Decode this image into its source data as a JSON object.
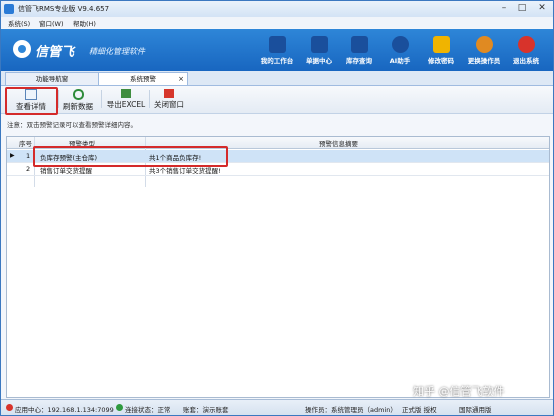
{
  "window": {
    "title": "信管飞RMS专业版 V9.4.657"
  },
  "menu": [
    "系统(S)",
    "窗口(W)",
    "帮助(H)"
  ],
  "banner": {
    "logo": "信管飞",
    "slogan": "精细化管理软件",
    "tools": [
      {
        "label": "我的工作台",
        "icon": "monitor-icon",
        "color": "#1a4f9c"
      },
      {
        "label": "单据中心",
        "icon": "document-list-icon",
        "color": "#1a4f9c"
      },
      {
        "label": "库存查询",
        "icon": "warehouse-icon",
        "color": "#1a4f9c"
      },
      {
        "label": "AI助手",
        "icon": "info-bubble-icon",
        "color": "#1a4f9c"
      },
      {
        "label": "修改密码",
        "icon": "lock-icon",
        "color": "#f0b400"
      },
      {
        "label": "更换操作员",
        "icon": "user-icon",
        "color": "#e08a22"
      },
      {
        "label": "退出系统",
        "icon": "close-circle-icon",
        "color": "#d8332b"
      }
    ]
  },
  "tabs": [
    "功能导航窗",
    "系统预警"
  ],
  "toolbar": [
    {
      "label": "查看详情",
      "icon": "view-details-icon"
    },
    {
      "label": "刷新数据",
      "icon": "refresh-icon"
    },
    {
      "label": "导出EXCEL",
      "icon": "export-excel-icon"
    },
    {
      "label": "关闭窗口",
      "icon": "close-window-icon"
    }
  ],
  "note": "注意：双击预警记录可以查看预警详细内容。",
  "grid": {
    "columns": [
      "序号",
      "预警类型",
      "预警信息摘要"
    ],
    "rows": [
      {
        "no": "1",
        "type": "负库存预警(主仓库)",
        "summary": "共1个商品负库存!"
      },
      {
        "no": "2",
        "type": "销售订单交货提醒",
        "summary": "共3个销售订单交货提醒!"
      }
    ]
  },
  "status": {
    "server": "应用中心：192.168.1.134:7099",
    "connection": "连接状态：正常",
    "account": "账套：演示账套",
    "operator": "操作员：系统管理员（admin）",
    "version": "正式版 授权",
    "tip": "国际通用版"
  },
  "watermark": "知乎 @信管飞软件"
}
